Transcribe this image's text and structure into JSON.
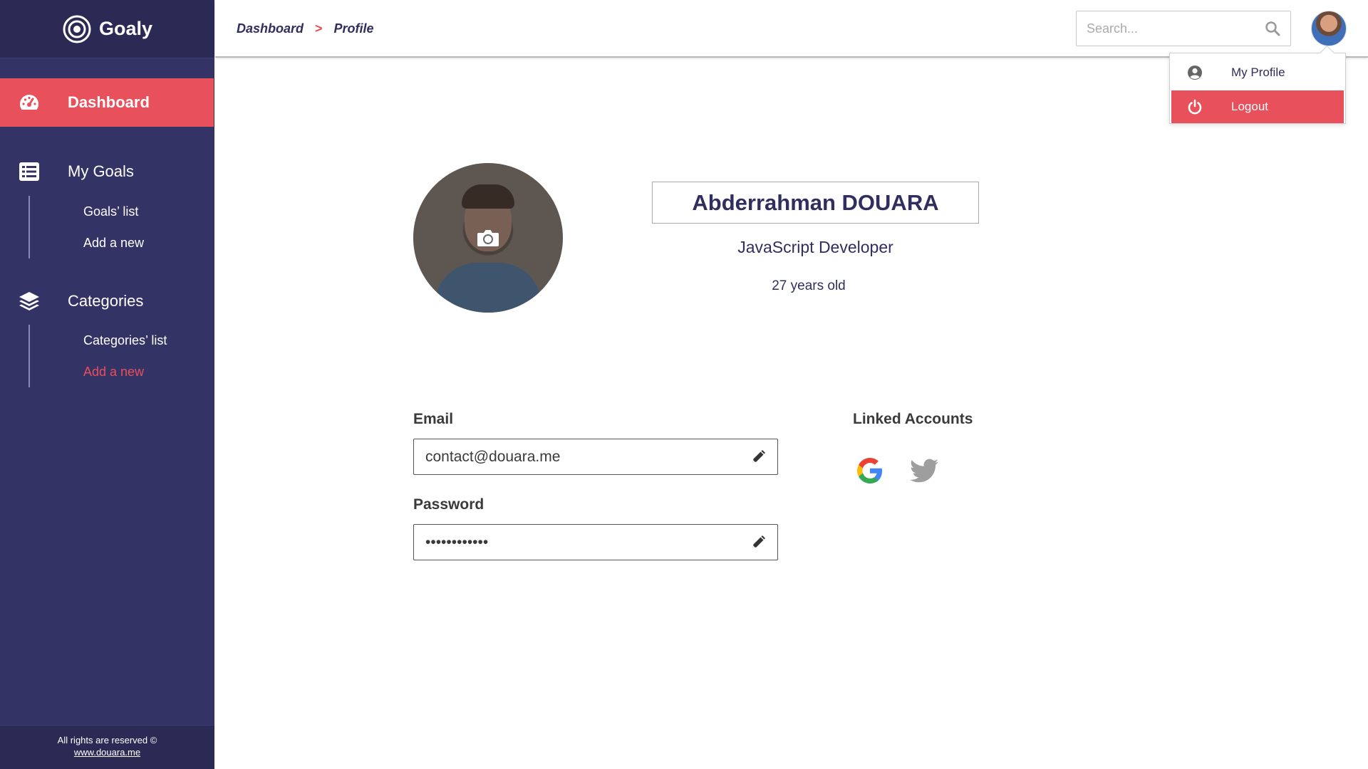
{
  "app": {
    "name": "Goaly"
  },
  "colors": {
    "sidebar": "#333366",
    "accent": "#e8505b",
    "text": "#2f2e5f"
  },
  "sidebar": {
    "dashboard_label": "Dashboard",
    "goals_label": "My Goals",
    "goals_items": [
      "Goals’ list",
      "Add a new"
    ],
    "categories_label": "Categories",
    "categories_items": [
      "Categories’ list",
      "Add a new"
    ],
    "footer_text": "All rights are reserved ©",
    "footer_link": "www.douara.me"
  },
  "header": {
    "breadcrumb": [
      "Dashboard",
      "Profile"
    ],
    "breadcrumb_sep": ">",
    "search_placeholder": "Search..."
  },
  "user_menu": {
    "items": [
      {
        "label": "My Profile",
        "icon": "user-circle-icon"
      },
      {
        "label": "Logout",
        "icon": "power-icon"
      }
    ]
  },
  "profile": {
    "name": "Abderrahman DOUARA",
    "job": "JavaScript Developer",
    "age": "27 years old",
    "email_label": "Email",
    "email": "contact@douara.me",
    "password_label": "Password",
    "password": "••••••••••••",
    "linked_label": "Linked Accounts",
    "linked": [
      "google-icon",
      "twitter-icon"
    ]
  }
}
